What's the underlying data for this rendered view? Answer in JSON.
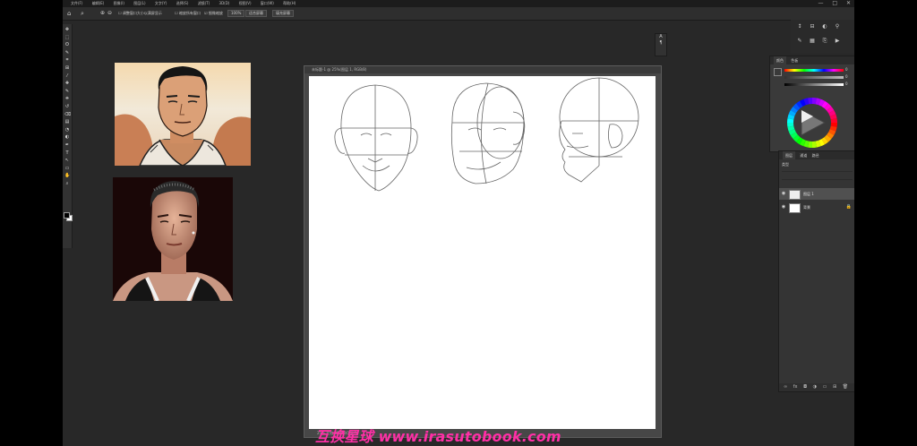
{
  "menubar": {
    "items": [
      "文件(F)",
      "编辑(E)",
      "图像(I)",
      "图层(L)",
      "文字(Y)",
      "选择(S)",
      "滤镜(T)",
      "3D(D)",
      "视图(V)",
      "窗口(W)",
      "帮助(H)"
    ],
    "window_controls": [
      "—",
      "□",
      "✕"
    ]
  },
  "options_bar": {
    "home_icon": "home-icon",
    "zoom_in_icon": "zoom-in-icon",
    "zoom_out_icon": "zoom-out-icon",
    "resize_windows_label": "调整窗口大小以满屏显示",
    "zoom_all_label": "缩放所有窗口",
    "scrubby_zoom_label": "细微缩放",
    "zoom_value": "100%",
    "fit_screen_label": "适合屏幕",
    "fill_screen_label": "填充屏幕"
  },
  "toolbox": {
    "tools": [
      "move-tool",
      "marquee-tool",
      "lasso-tool",
      "quick-select-tool",
      "crop-tool",
      "frame-tool",
      "eyedropper-tool",
      "healing-tool",
      "brush-tool",
      "stamp-tool",
      "history-brush-tool",
      "eraser-tool",
      "gradient-tool",
      "blur-tool",
      "dodge-tool",
      "pen-tool",
      "type-tool",
      "path-select-tool",
      "shape-tool",
      "hand-tool",
      "zoom-tool"
    ],
    "glyphs": [
      "✥",
      "⬚",
      "ʘ",
      "✎",
      "⌗",
      "⊞",
      "⁄",
      "✚",
      "✎",
      "⎈",
      "↺",
      "⌫",
      "▤",
      "◔",
      "◐",
      "✒",
      "T",
      "↖",
      "▭",
      "✋",
      "⌕"
    ],
    "foreground_color": "#000000",
    "background_color": "#ffffff"
  },
  "document": {
    "tab_title": "未标题-1 @ 25%(图层 1, RGB/8)",
    "status_text": "25%   文档:25.6M/0 字节"
  },
  "color_panel": {
    "tabs": [
      "颜色",
      "色板"
    ],
    "sliders": [
      {
        "label": "H",
        "value": "0"
      },
      {
        "label": "S",
        "value": "0"
      },
      {
        "label": "B",
        "value": "0"
      }
    ],
    "wheel_colors": [
      "#ff0000",
      "#ffff00",
      "#00ff00",
      "#00ffff",
      "#0000ff",
      "#ff00ff"
    ]
  },
  "layers_panel": {
    "tabs": [
      "图层",
      "通道",
      "路径"
    ],
    "kind_label": "类型",
    "layers": [
      {
        "name": "图层 1",
        "selected": true,
        "lock": ""
      },
      {
        "name": "背景",
        "selected": false,
        "lock": "🔒"
      }
    ],
    "footer_icons": [
      "link-icon",
      "fx-icon",
      "mask-icon",
      "adjustment-icon",
      "group-icon",
      "new-layer-icon",
      "trash-icon"
    ],
    "footer_glyphs": [
      "∞",
      "fx",
      "◘",
      "◑",
      "▭",
      "⊞",
      "🗑"
    ]
  },
  "watermark": "互换星球 www.irasutobook.com"
}
